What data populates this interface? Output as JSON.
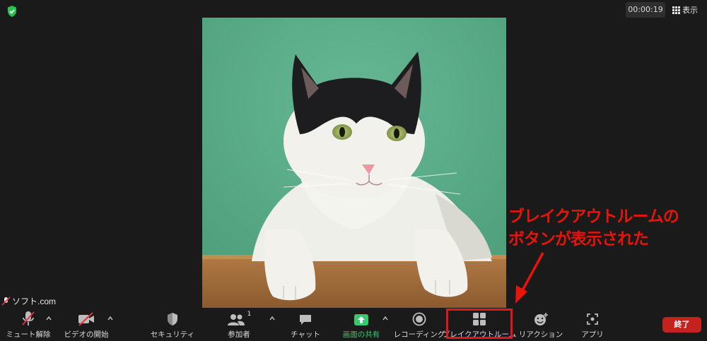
{
  "meeting": {
    "timer": "00:00:19",
    "view_label": "表示",
    "watermark": "ソフト.com",
    "participant_count": "1"
  },
  "annotation": {
    "line1": "ブレイクアウトルームの",
    "line2": "ボタンが表示された",
    "color": "#e8140c"
  },
  "toolbar": {
    "mute": "ミュート解除",
    "video": "ビデオの開始",
    "security": "セキュリティ",
    "participants": "参加者",
    "chat": "チャット",
    "share": "画面の共有",
    "record": "レコーディング",
    "breakout": "ブレイクアウトルーム",
    "reactions": "リアクション",
    "apps": "アプリ",
    "end": "終了"
  },
  "colors": {
    "share_green": "#38c96d",
    "end_red": "#c4221f",
    "highlight_red": "#e6141e"
  }
}
